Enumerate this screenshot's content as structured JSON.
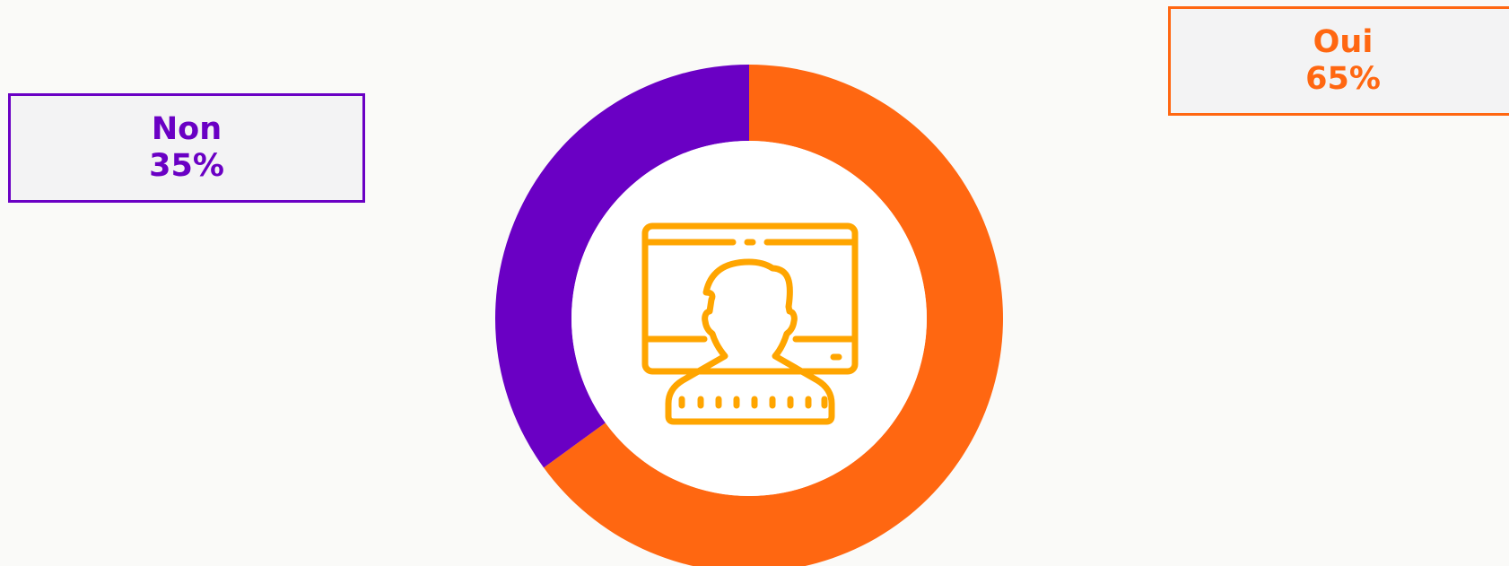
{
  "chart_data": {
    "type": "pie",
    "variant": "donut",
    "slices": [
      {
        "label": "Oui",
        "value": 65,
        "value_label": "65%",
        "color": "#ff6711"
      },
      {
        "label": "Non",
        "value": 35,
        "value_label": "35%",
        "color": "#6a00c4"
      }
    ],
    "center_icon": "video-call-person-icon",
    "icon_color": "#ffa500"
  }
}
